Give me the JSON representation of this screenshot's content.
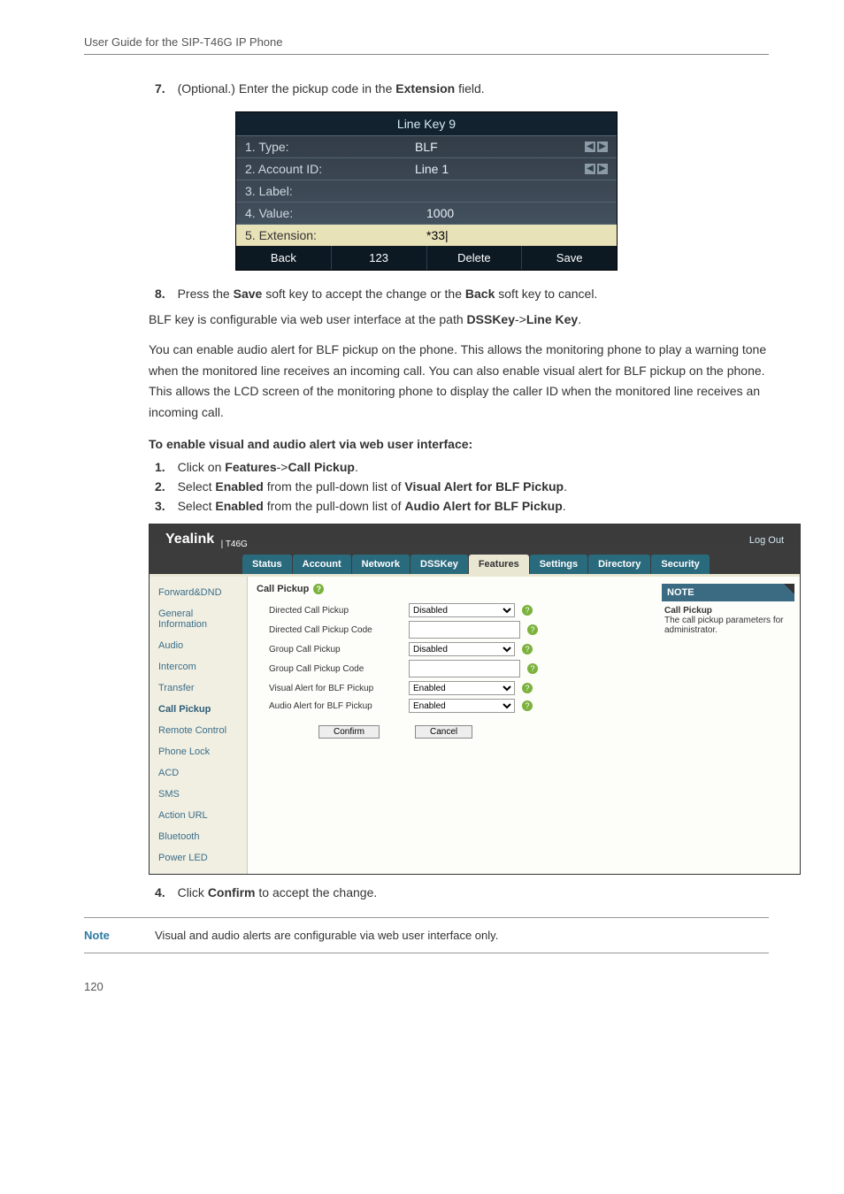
{
  "header": "User Guide for the SIP-T46G IP Phone",
  "step7": {
    "num": "7.",
    "pre": "(Optional.) Enter the pickup code in the ",
    "bold": "Extension",
    "post": " field."
  },
  "phone": {
    "title": "Line Key 9",
    "r1l": "1. Type:",
    "r1v": "BLF",
    "r2l": "2. Account ID:",
    "r2v": "Line 1",
    "r3l": "3. Label:",
    "r3v": "",
    "r4l": "4. Value:",
    "r4v": "1000",
    "r5l": "5. Extension:",
    "r5v": "*33|",
    "sk1": "Back",
    "sk2": "123",
    "sk3": "Delete",
    "sk4": "Save"
  },
  "step8": {
    "num": "8.",
    "pre": "Press the ",
    "b1": "Save",
    "mid": " soft key to accept the change or the ",
    "b2": "Back",
    "post": " soft key to cancel."
  },
  "para1": {
    "pre": "BLF key is configurable via web user interface at the path ",
    "b1": "DSSKey",
    "arrow": "->",
    "b2": "Line Key",
    "dot": "."
  },
  "para2": "You can enable audio alert for BLF pickup on the phone. This allows the monitoring phone to play a warning tone when the monitored line receives an incoming call. You can also enable visual alert for BLF pickup on the phone. This allows the LCD screen of the monitoring phone to display the caller ID when the monitored line receives an incoming call.",
  "section": "To enable visual and audio alert via web user interface:",
  "s1": {
    "num": "1.",
    "pre": "Click on ",
    "b1": "Features",
    "arrow": "->",
    "b2": "Call Pickup",
    "dot": "."
  },
  "s2": {
    "num": "2.",
    "pre": "Select ",
    "b1": "Enabled",
    "mid": " from the pull-down list of ",
    "b2": "Visual Alert for BLF Pickup",
    "dot": "."
  },
  "s3": {
    "num": "3.",
    "pre": "Select ",
    "b1": "Enabled",
    "mid": " from the pull-down list of ",
    "b2": "Audio Alert for BLF Pickup",
    "dot": "."
  },
  "webui": {
    "brand": "Yealink",
    "model": "T46G",
    "logout": "Log Out",
    "tabs": [
      "Status",
      "Account",
      "Network",
      "DSSKey",
      "Features",
      "Settings",
      "Directory",
      "Security"
    ],
    "activeTab": "Features",
    "sidebar": [
      "Forward&DND",
      "General Information",
      "Audio",
      "Intercom",
      "Transfer",
      "Call Pickup",
      "Remote Control",
      "Phone Lock",
      "ACD",
      "SMS",
      "Action URL",
      "Bluetooth",
      "Power LED"
    ],
    "activeSide": "Call Pickup",
    "contentHead": "Call Pickup",
    "rows": {
      "dcp": "Directed Call Pickup",
      "dcpc": "Directed Call Pickup Code",
      "gcp": "Group Call Pickup",
      "gcpc": "Group Call Pickup Code",
      "va": "Visual Alert for BLF Pickup",
      "aa": "Audio Alert for BLF Pickup"
    },
    "vals": {
      "dcp": "Disabled",
      "gcp": "Disabled",
      "va": "Enabled",
      "aa": "Enabled"
    },
    "confirm": "Confirm",
    "cancel": "Cancel",
    "noteHead": "NOTE",
    "noteTitle": "Call Pickup",
    "noteBody": "The call pickup parameters for administrator."
  },
  "step4": {
    "num": "4.",
    "pre": "Click ",
    "b1": "Confirm",
    "post": " to accept the change."
  },
  "bottomNote": {
    "label": "Note",
    "text": "Visual and audio alerts are configurable via web user interface only."
  },
  "pageNum": "120"
}
